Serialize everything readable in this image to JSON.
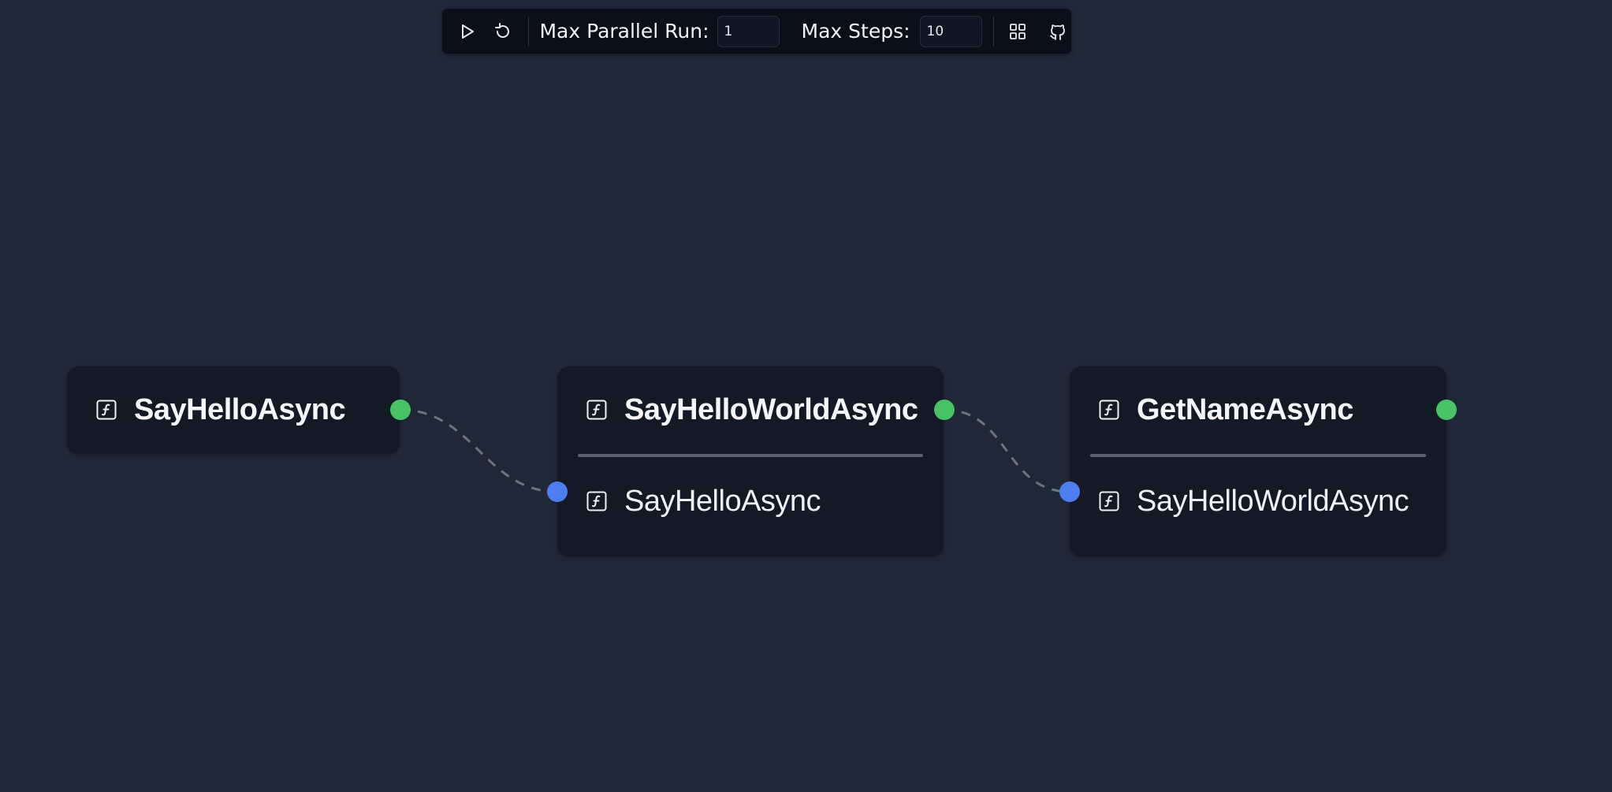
{
  "toolbar": {
    "run_icon": "play-icon",
    "reset_icon": "reset-icon",
    "max_parallel_label": "Max Parallel Run:",
    "max_parallel_value": "1",
    "max_steps_label": "Max Steps:",
    "max_steps_value": "10",
    "layout_icon": "grid-layout-icon",
    "github_icon": "github-icon"
  },
  "nodes": [
    {
      "title": "SayHelloAsync",
      "dependencies": []
    },
    {
      "title": "SayHelloWorldAsync",
      "dependencies": [
        "SayHelloAsync"
      ]
    },
    {
      "title": "GetNameAsync",
      "dependencies": [
        "SayHelloWorldAsync"
      ]
    }
  ],
  "node_icon": "function-icon",
  "colors": {
    "background": "#202838",
    "node_bg": "#141926",
    "toolbar_bg": "#0b0f19",
    "output_handle": "#47c265",
    "input_handle": "#4d7df0",
    "edge": "#6b7280",
    "divider": "#5b6070"
  }
}
